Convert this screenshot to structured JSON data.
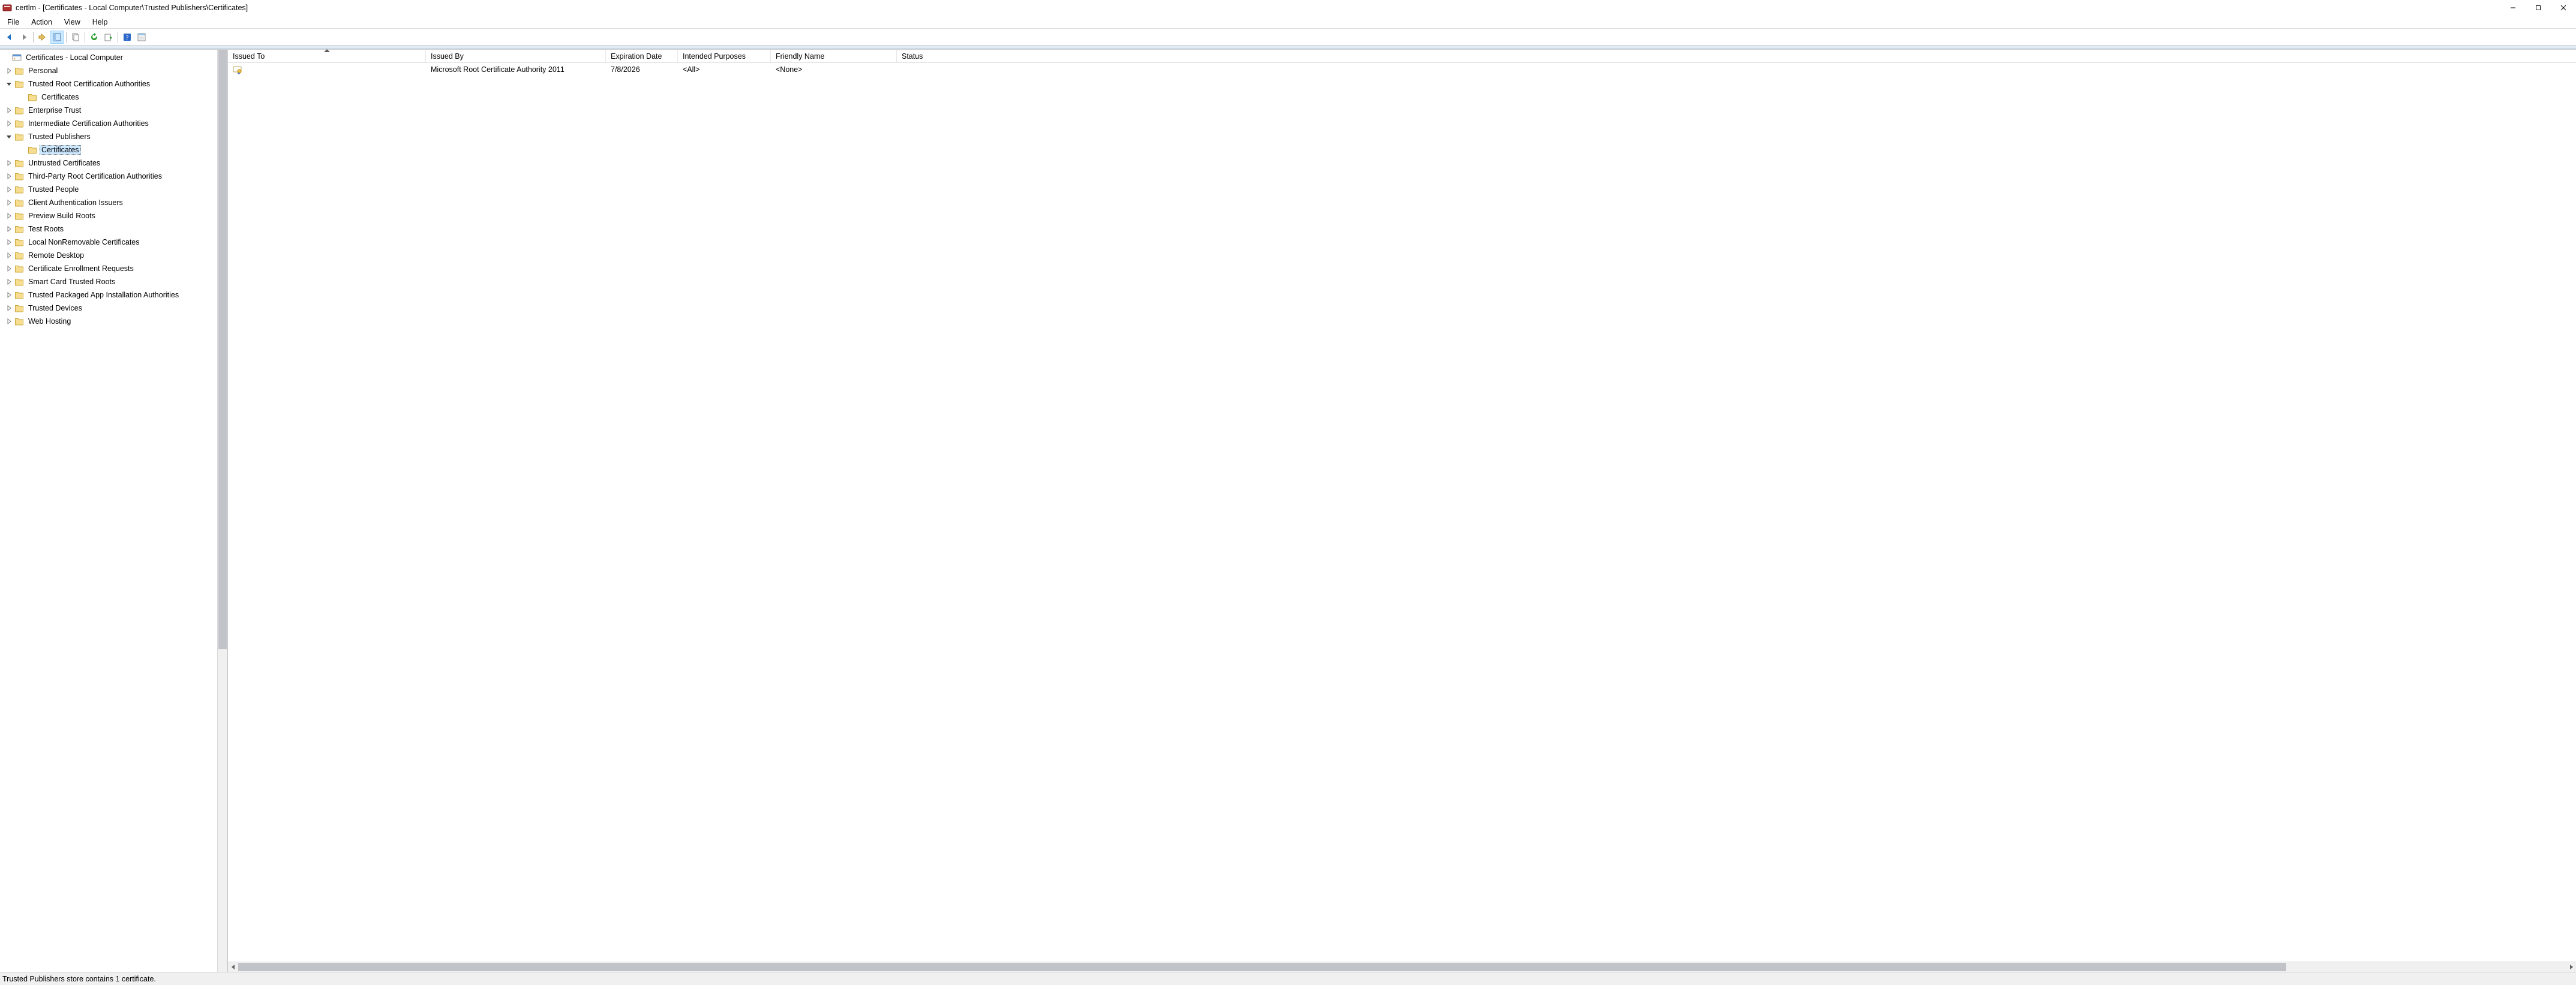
{
  "window": {
    "title": "certlm - [Certificates - Local Computer\\Trusted Publishers\\Certificates]"
  },
  "menu": {
    "file": "File",
    "action": "Action",
    "view": "View",
    "help": "Help"
  },
  "tree": {
    "root": "Certificates - Local Computer",
    "nodes": [
      {
        "label": "Personal",
        "expandable": true
      },
      {
        "label": "Trusted Root Certification Authorities",
        "expandable": true,
        "expanded": true,
        "children": [
          {
            "label": "Certificates"
          }
        ]
      },
      {
        "label": "Enterprise Trust",
        "expandable": true
      },
      {
        "label": "Intermediate Certification Authorities",
        "expandable": true
      },
      {
        "label": "Trusted Publishers",
        "expandable": true,
        "expanded": true,
        "children": [
          {
            "label": "Certificates",
            "selected": true
          }
        ]
      },
      {
        "label": "Untrusted Certificates",
        "expandable": true
      },
      {
        "label": "Third-Party Root Certification Authorities",
        "expandable": true
      },
      {
        "label": "Trusted People",
        "expandable": true
      },
      {
        "label": "Client Authentication Issuers",
        "expandable": true
      },
      {
        "label": "Preview Build Roots",
        "expandable": true
      },
      {
        "label": "Test Roots",
        "expandable": true
      },
      {
        "label": "Local NonRemovable Certificates",
        "expandable": true
      },
      {
        "label": "Remote Desktop",
        "expandable": true
      },
      {
        "label": "Certificate Enrollment Requests",
        "expandable": true
      },
      {
        "label": "Smart Card Trusted Roots",
        "expandable": true
      },
      {
        "label": "Trusted Packaged App Installation Authorities",
        "expandable": true
      },
      {
        "label": "Trusted Devices",
        "expandable": true
      },
      {
        "label": "Web Hosting",
        "expandable": true
      }
    ]
  },
  "columns": {
    "issued_to": "Issued To",
    "issued_by": "Issued By",
    "expiration": "Expiration Date",
    "purposes": "Intended Purposes",
    "friendly": "Friendly Name",
    "status": "Status"
  },
  "rows": [
    {
      "issued_to": "",
      "issued_by": "Microsoft Root Certificate Authority 2011",
      "expiration": "7/8/2026",
      "purposes": "<All>",
      "friendly": "<None>",
      "status": ""
    }
  ],
  "status": {
    "text": "Trusted Publishers store contains 1 certificate."
  }
}
